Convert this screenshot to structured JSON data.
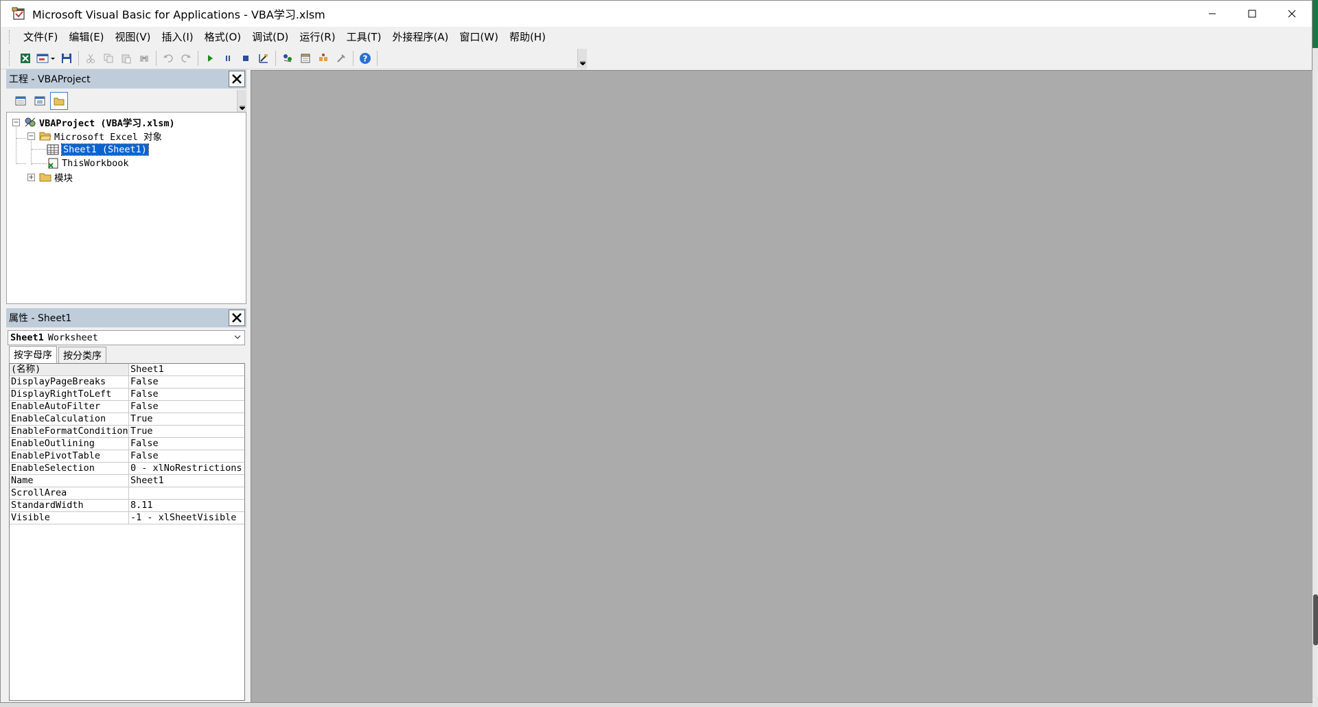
{
  "window": {
    "title": "Microsoft Visual Basic for Applications - VBA学习.xlsm",
    "controls": [
      "minimize-icon",
      "maximize-icon",
      "close-icon"
    ]
  },
  "menu": {
    "items": [
      "文件(F)",
      "编辑(E)",
      "视图(V)",
      "插入(I)",
      "格式(O)",
      "调试(D)",
      "运行(R)",
      "工具(T)",
      "外接程序(A)",
      "窗口(W)",
      "帮助(H)"
    ]
  },
  "toolbar": {
    "icons": [
      "excel-view-icon",
      "insert-userform-icon",
      "save-icon",
      "cut-icon",
      "copy-icon",
      "paste-icon",
      "find-icon",
      "undo-icon",
      "redo-icon",
      "run-icon",
      "break-icon",
      "reset-icon",
      "design-mode-icon",
      "project-explorer-icon",
      "properties-icon",
      "object-browser-icon",
      "toolbox-icon",
      "help-icon"
    ]
  },
  "project": {
    "title": "工程 - VBAProject",
    "tree": {
      "root": "VBAProject (VBA学习.xlsm)",
      "excel_objects": "Microsoft Excel 对象",
      "sheet1": "Sheet1 (Sheet1)",
      "workbook": "ThisWorkbook",
      "modules": "模块"
    }
  },
  "properties": {
    "title": "属性 - Sheet1",
    "object_name": "Sheet1",
    "object_type": "Worksheet",
    "tabs": [
      "按字母序",
      "按分类序"
    ],
    "rows": [
      {
        "name": "(名称)",
        "value": "Sheet1"
      },
      {
        "name": "DisplayPageBreaks",
        "value": "False"
      },
      {
        "name": "DisplayRightToLeft",
        "value": "False"
      },
      {
        "name": "EnableAutoFilter",
        "value": "False"
      },
      {
        "name": "EnableCalculation",
        "value": "True"
      },
      {
        "name": "EnableFormatConditions",
        "value": "True"
      },
      {
        "name": "EnableOutlining",
        "value": "False"
      },
      {
        "name": "EnablePivotTable",
        "value": "False"
      },
      {
        "name": "EnableSelection",
        "value": "0 - xlNoRestrictions"
      },
      {
        "name": "Name",
        "value": "Sheet1"
      },
      {
        "name": "ScrollArea",
        "value": ""
      },
      {
        "name": "StandardWidth",
        "value": "8.11"
      },
      {
        "name": "Visible",
        "value": "-1 - xlSheetVisible"
      }
    ]
  },
  "colors": {
    "pane_title": "#bfcddb",
    "workspace": "#ababab",
    "selection": "#0a64d0",
    "excel_green": "#217346"
  }
}
